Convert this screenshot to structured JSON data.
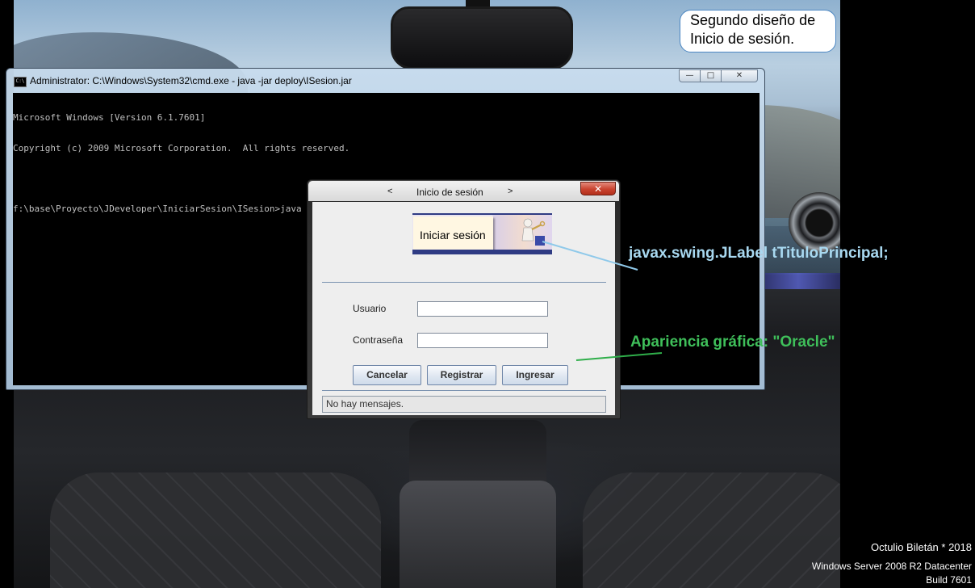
{
  "note": {
    "line1": "Segundo diseño de",
    "line2": "Inicio de sesión."
  },
  "console": {
    "title": "Administrator: C:\\Windows\\System32\\cmd.exe - java  -jar deploy\\ISesion.jar",
    "lines": [
      "Microsoft Windows [Version 6.1.7601]",
      "Copyright (c) 2009 Microsoft Corporation.  All rights reserved.",
      "",
      "f:\\base\\Proyecto\\JDeveloper\\IniciarSesion\\ISesion>java -jar deploy\\ISesion.jar"
    ],
    "colors": {
      "background": "#000000",
      "text": "#c0c0c0"
    }
  },
  "login": {
    "title": "Inicio de sesión",
    "prev": "<",
    "next": ">",
    "banner_text": "Iniciar sesión",
    "user_label": "Usuario",
    "password_label": "Contraseña",
    "user_value": "",
    "password_value": "",
    "buttons": {
      "cancel": "Cancelar",
      "register": "Registrar",
      "login": "Ingresar"
    },
    "status": "No hay mensajes."
  },
  "annotations": {
    "label_class": "javax.swing.JLabel tTituloPrincipal;",
    "look_and_feel": "Apariencia gráfica: \"Oracle\"",
    "colors": {
      "label_class": "#a8d8f0",
      "look_and_feel": "#3fbf5a"
    }
  },
  "watermark": {
    "author": "Octulio Biletán * 2018",
    "os": "Windows Server 2008 R2 Datacenter",
    "build": "Build 7601"
  }
}
